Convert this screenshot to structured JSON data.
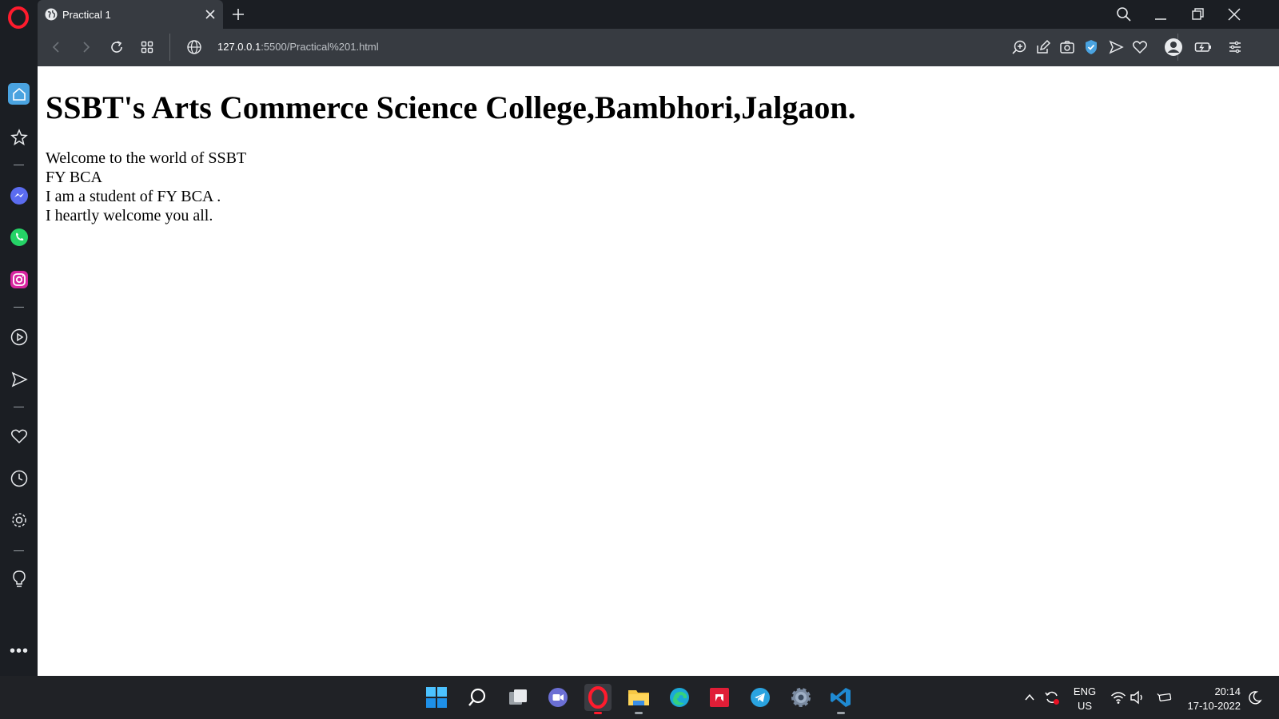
{
  "browser": {
    "tab": {
      "title": "Practical 1"
    },
    "address": {
      "host": "127.0.0.1",
      "path": ":5500/Practical%201.html"
    }
  },
  "page": {
    "heading": "SSBT's Arts Commerce Science College,Bambhori,Jalgaon.",
    "lines": [
      "Welcome to the world of SSBT",
      "FY BCA",
      "I am a student of FY BCA .",
      "I heartly welcome you all."
    ]
  },
  "taskbar": {
    "language": "ENG",
    "region": "US",
    "time": "20:14",
    "date": "17-10-2022"
  },
  "colors": {
    "opera_red": "#ff1b2d",
    "accent_blue": "#4aa3e0",
    "chrome_dark": "#1b1e23",
    "toolbar": "#373b41"
  }
}
